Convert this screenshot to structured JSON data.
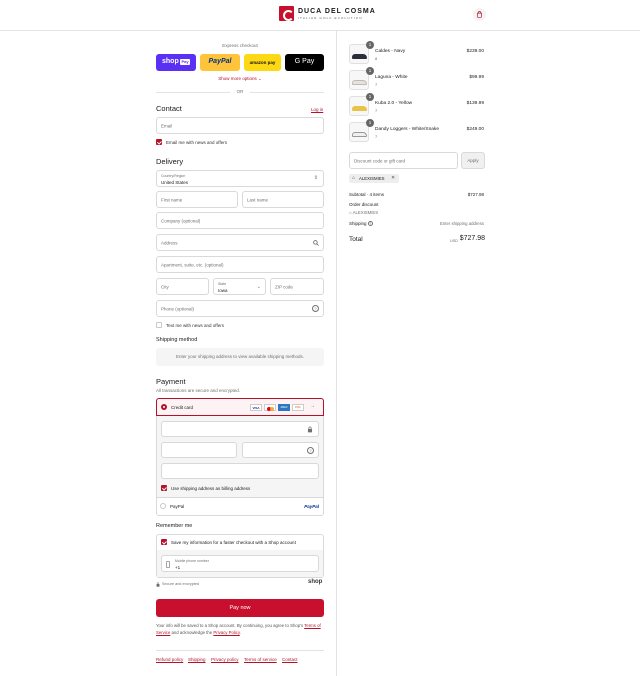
{
  "header": {
    "brand": "DUCA DEL COSMA",
    "tagline": "ITALIAN GOLF EVOLUTION"
  },
  "express": {
    "title": "Express checkout",
    "shop_label": "shop",
    "shop_badge": "Pay",
    "paypal_label": "PayPal",
    "amazon_label": "amazon pay",
    "gpay_label": "G Pay",
    "more_options": "Show more options",
    "or": "OR"
  },
  "contact": {
    "heading": "Contact",
    "login": "Log in",
    "email_placeholder": "Email",
    "news_label": "Email me with news and offers"
  },
  "delivery": {
    "heading": "Delivery",
    "country_label": "Country/Region",
    "country_value": "United States",
    "first_name": "First name",
    "last_name": "Last name",
    "company": "Company (optional)",
    "address": "Address",
    "apartment": "Apartment, suite, etc. (optional)",
    "city": "City",
    "state_label": "State",
    "state_value": "Iowa",
    "zip": "ZIP code",
    "phone": "Phone (optional)",
    "text_label": "Text me with news and offers"
  },
  "shipping_method": {
    "heading": "Shipping method",
    "notice": "Enter your shipping address to view available shipping methods."
  },
  "payment": {
    "heading": "Payment",
    "subtitle": "All transactions are secure and encrypted.",
    "credit_card": "Credit card",
    "card_brands": [
      "VISA",
      "MC",
      "AMEX",
      "DISC"
    ],
    "billing_label": "Use shipping address as billing address",
    "paypal": "PayPal",
    "paypal_logo": "PayPal"
  },
  "remember": {
    "heading": "Remember me",
    "save_label": "Save my information for a faster checkout with a Shop account",
    "mobile_label": "Mobile phone number",
    "mobile_value": "+1",
    "secure_text": "Secure and encrypted",
    "shop_logo": "shop"
  },
  "pay_now": "Pay now",
  "legal": {
    "prefix": "Your info will be saved to a Shop account. By continuing, you agree to Shop's",
    "tos": "Terms of Service",
    "middle": "and acknowledge the",
    "privacy": "Privacy Policy",
    "suffix": "."
  },
  "footer": [
    "Refund policy",
    "Shipping",
    "Privacy policy",
    "Terms of service",
    "Contact"
  ],
  "order": {
    "items": [
      {
        "name": "Caldes - Navy",
        "variant": "8",
        "qty": "1",
        "price": "$239.00"
      },
      {
        "name": "Laguna - White",
        "variant": "7",
        "qty": "1",
        "price": "$99.99"
      },
      {
        "name": "Kuba 2.0 - Yellow",
        "variant": "7",
        "qty": "1",
        "price": "$139.99"
      },
      {
        "name": "Dandy Loggers - White/Snake",
        "variant": "7",
        "qty": "1",
        "price": "$249.00"
      }
    ],
    "discount_placeholder": "Discount code or gift card",
    "apply": "Apply",
    "code": "ALEXISMIES",
    "subtotal_label": "Subtotal · 4 items",
    "subtotal_value": "$727.98",
    "order_discount": "Order discount",
    "discount_code": "ALEXISMIES",
    "shipping_label": "Shipping",
    "shipping_value": "Enter shipping address",
    "total_label": "Total",
    "currency": "USD",
    "total_value": "$727.98"
  },
  "colors": {
    "accent": "#b5122a",
    "shop_purple": "#5a31f4",
    "paypal_yellow": "#ffc439",
    "amazon_yellow": "#ffd814"
  }
}
